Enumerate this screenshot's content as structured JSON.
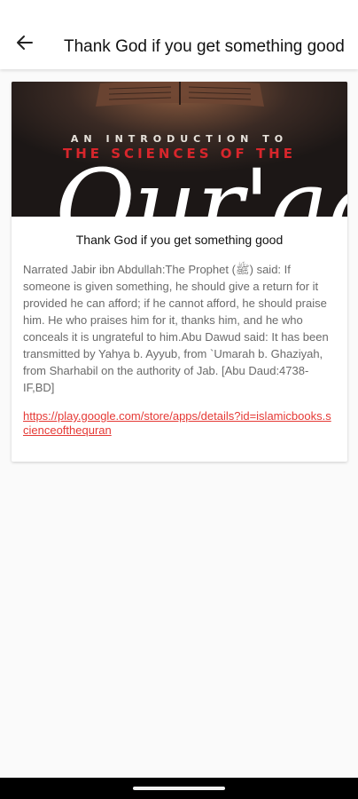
{
  "header": {
    "title": "Thank God if you get something good",
    "back_icon": "arrow-back-icon"
  },
  "card": {
    "cover": {
      "line1": "AN INTRODUCTION TO",
      "line2": "THE SCIENCES OF THE",
      "big_word": "Qur'aan"
    },
    "title": "Thank God if you get something good",
    "body": "Narrated Jabir ibn Abdullah:The Prophet (ﷺ) said: If someone is given something, he should give a return for it provided he can afford; if he cannot afford, he should praise him. He who praises him for it, thanks him, and he who conceals it is ungrateful to him.Abu Dawud said: It has been transmitted by Yahya b. Ayyub, from `Umarah b. Ghaziyah, from Sharhabil on the authority of Jab.  [Abu Daud:4738- IF,BD]",
    "link": "https://play.google.com/store/apps/details?id=islamicbooks.scienceofthequran"
  },
  "colors": {
    "link": "#e53935",
    "cover_red": "#d8262c",
    "background": "#fafafa"
  }
}
